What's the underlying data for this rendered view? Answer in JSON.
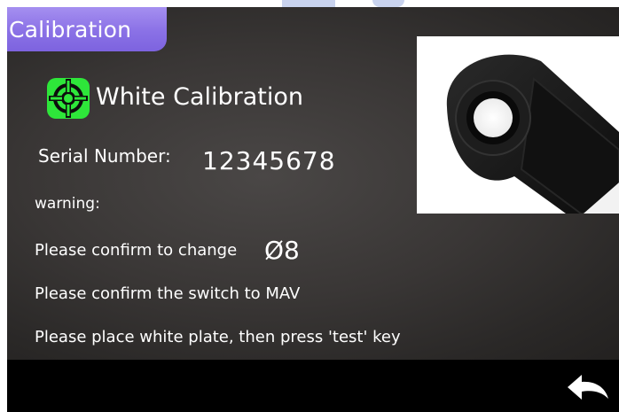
{
  "window": {
    "title": "Calibration"
  },
  "main": {
    "heading": "White Calibration",
    "heading_icon": "calibration-target-icon",
    "serial": {
      "label": "Serial Number:",
      "value": "12345678"
    },
    "warning_label": "warning:",
    "messages": [
      {
        "text": "Please confirm to change",
        "suffix": "Ø8"
      },
      {
        "text": "Please confirm the switch to MAV"
      },
      {
        "text": "Please place white plate, then press 'test' key"
      }
    ]
  },
  "bottom_bar": {
    "back_icon": "back-arrow-icon"
  },
  "colors": {
    "title_tab": "#8a71e6",
    "panel_background": "#393635",
    "icon_green": "#2ee63a",
    "text": "#ffffff",
    "bottom_bar": "#000000"
  }
}
